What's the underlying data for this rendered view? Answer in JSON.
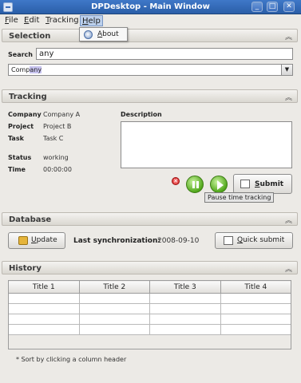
{
  "window": {
    "title": "DPDesktop - Main Window",
    "controls": {
      "minimize": "_",
      "maximize": "□",
      "close": "✕"
    }
  },
  "menu": {
    "items": [
      {
        "prefix": "",
        "accel": "F",
        "rest": "ile"
      },
      {
        "prefix": "",
        "accel": "E",
        "rest": "dit"
      },
      {
        "prefix": "",
        "accel": "T",
        "rest": "racking"
      },
      {
        "prefix": "",
        "accel": "H",
        "rest": "elp"
      }
    ],
    "help_dropdown": {
      "prefix": "",
      "accel": "A",
      "rest": "bout",
      "icon": "info-icon"
    }
  },
  "selection": {
    "title": "Selection",
    "search_label": "Search",
    "search_value": "any",
    "combo_prefix": "Comp",
    "combo_highlight": "any",
    "combo_arrow": "▼",
    "collapse_glyph": "︽"
  },
  "tracking": {
    "title": "Tracking",
    "collapse_glyph": "︽",
    "fields": [
      {
        "label": "Company",
        "value": "Company A"
      },
      {
        "label": "Project",
        "value": "Project B"
      },
      {
        "label": "Task",
        "value": "Task C"
      },
      {
        "label": "Status",
        "value": "working"
      },
      {
        "label": "Time",
        "value": "00:00:00"
      }
    ],
    "description_label": "Description",
    "description_value": "",
    "stop_glyph": "✕",
    "submit_prefix": "",
    "submit_accel": "S",
    "submit_rest": "ubmit",
    "tooltip": "Pause time tracking"
  },
  "database": {
    "title": "Database",
    "collapse_glyph": "︽",
    "update_prefix": "",
    "update_accel": "U",
    "update_rest": "pdate",
    "sync_label": "Last synchronization:",
    "sync_value": "2008-09-10",
    "quick_prefix": "",
    "quick_accel": "Q",
    "quick_rest": "uick submit"
  },
  "history": {
    "title": "History",
    "collapse_glyph": "︽",
    "columns": [
      "Title 1",
      "Title 2",
      "Title 3",
      "Title 4"
    ],
    "rows": [
      [
        "",
        "",
        "",
        ""
      ],
      [
        "",
        "",
        "",
        ""
      ],
      [
        "",
        "",
        "",
        ""
      ],
      [
        "",
        "",
        "",
        ""
      ]
    ],
    "footnote": "* Sort by clicking a column header"
  },
  "colors": {
    "titlebar": "#2a5ea8",
    "highlight": "#c8c4f0",
    "play_green": "#52a81c",
    "stop_red": "#d21f1f"
  }
}
